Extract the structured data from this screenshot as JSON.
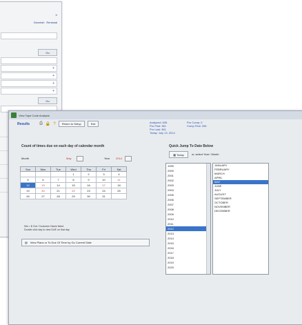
{
  "bg_window": {
    "top_links": [
      "Ir",
      "Gecmish",
      "Renewal"
    ],
    "row_icons": [
      "+",
      "+",
      "+",
      "+"
    ],
    "btn_label": "Go"
  },
  "dialog": {
    "title": "View Tape Code Analysis",
    "toolbar_label": "Results",
    "return_label": "Return to Setup",
    "exit_label": "Exit",
    "info_left": [
      "Analyzed: 635",
      "Pro First: 361",
      "Pro Last: 361",
      "Today: July 13, 2014"
    ],
    "info_right": [
      "Pro Comp: 0",
      "Comp First: 206"
    ],
    "left": {
      "title": "Count of times due on each day of calendar month",
      "month_label": "Month",
      "month_value": "May",
      "year_label": "Year",
      "year_value": "2014",
      "days": [
        "Sun",
        "Mon",
        "Tue",
        "Wed",
        "Thu",
        "Fri",
        "Sat"
      ],
      "weeks": [
        [
          "",
          "",
          "",
          "1",
          "2",
          "3",
          "4"
        ],
        [
          "5",
          "6",
          "7",
          "8",
          "9",
          "10",
          "11"
        ],
        [
          "12",
          "13",
          "14",
          "15",
          "16",
          "17",
          "18"
        ],
        [
          "19",
          "20",
          "21",
          "22",
          "23",
          "24",
          "25"
        ],
        [
          "26",
          "27",
          "28",
          "29",
          "30",
          "31",
          ""
        ]
      ],
      "notes": [
        "Nbr = $ Out / Customer Name listed",
        "Double click day to view DUE on that day"
      ],
      "view_button": "View Plans or To Due Of Time by Go Current Date"
    },
    "right": {
      "title": "Quick Jump To Date Below",
      "today_label": "Today",
      "or_select": "or, select Year / Month",
      "years": [
        "1999",
        "2000",
        "2001",
        "2002",
        "2003",
        "2004",
        "2005",
        "2006",
        "2007",
        "2008",
        "2009",
        "2010",
        "2011",
        "2012",
        "2013",
        "2014",
        "2015",
        "2016",
        "2017",
        "2018",
        "2019",
        "2020"
      ],
      "selected_year": "2012",
      "months": [
        "JANUARY",
        "FEBRUARY",
        "MARCH",
        "APRIL",
        "MAY",
        "JUNE",
        "JULY",
        "AUGUST",
        "SEPTEMBER",
        "OCTOBER",
        "NOVEMBER",
        "DECEMBER"
      ],
      "selected_month": "MAY"
    }
  },
  "colors": {
    "accent": "#3a74c9",
    "highlight": "#c0392b"
  }
}
